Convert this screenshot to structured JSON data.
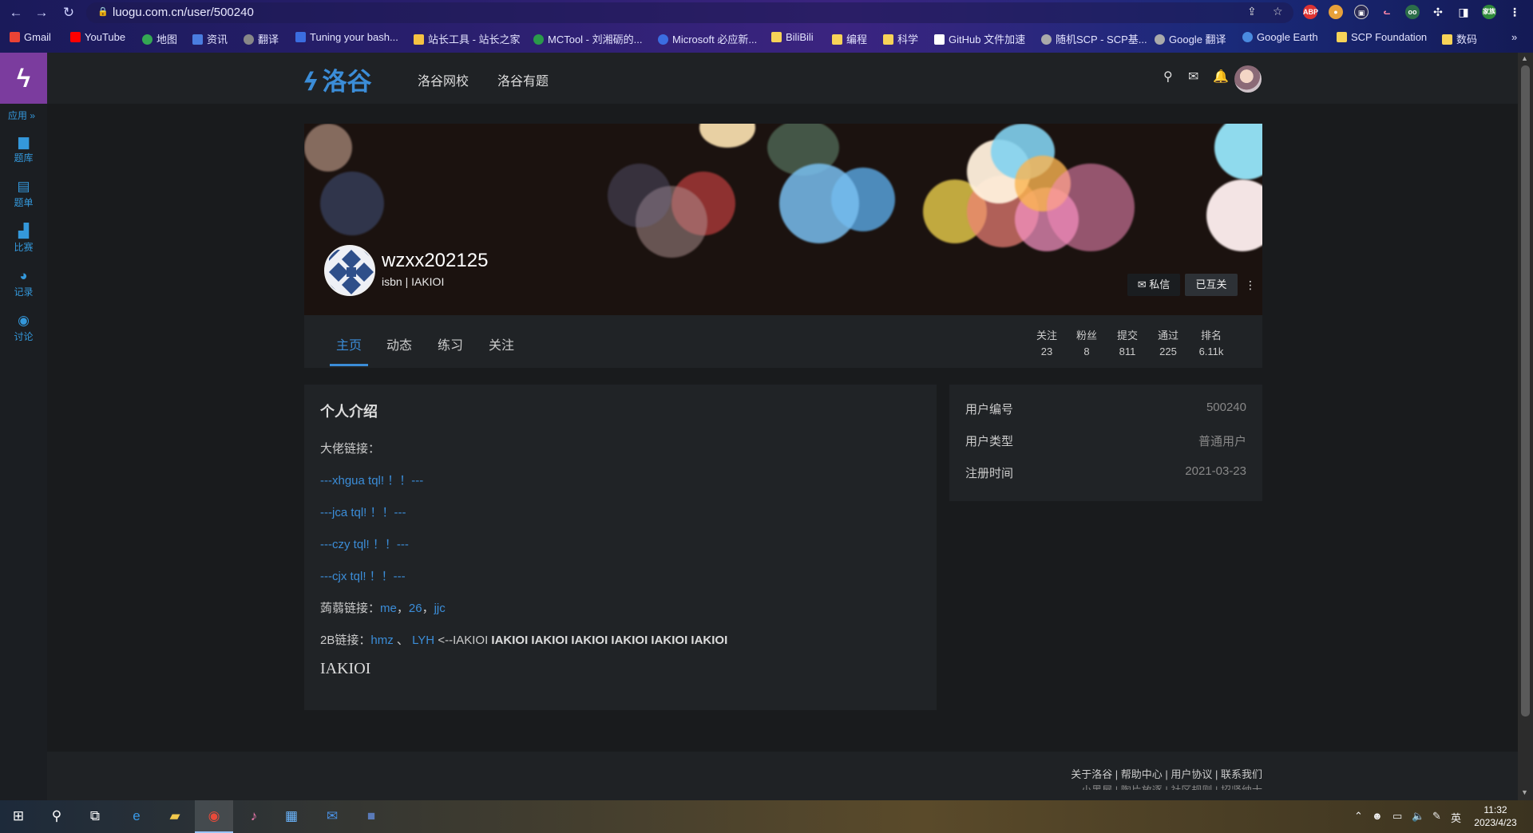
{
  "browser": {
    "url": "luogu.com.cn/user/500240",
    "bookmarks": [
      "Gmail",
      "YouTube",
      "地图",
      "资讯",
      "翻译",
      "Tuning your bash...",
      "站长工具 - 站长之家",
      "MCTool - 刘湘砺的...",
      "Microsoft 必应新...",
      "BiliBili",
      "编程",
      "科学",
      "GitHub 文件加速",
      "随机SCP - SCP基...",
      "Google 翻译",
      "Google Earth",
      "SCP Foundation",
      "数码"
    ],
    "more": "»",
    "profile_badge": "家族"
  },
  "appbar": {
    "menu_label": "应用",
    "items": [
      {
        "label": "题库",
        "icon": "book-icon"
      },
      {
        "label": "题单",
        "icon": "clipboard-icon"
      },
      {
        "label": "比赛",
        "icon": "bar-chart-icon"
      },
      {
        "label": "记录",
        "icon": "pie-chart-icon"
      },
      {
        "label": "讨论",
        "icon": "comments-icon"
      }
    ]
  },
  "site": {
    "brand": "洛谷",
    "nav": [
      "洛谷网校",
      "洛谷有题"
    ]
  },
  "profile": {
    "username": "wzxx202125",
    "tag": "isbn | IAKIOI",
    "msg_button": "私信",
    "follow_button": "已互关",
    "tabs": [
      "主页",
      "动态",
      "练习",
      "关注"
    ],
    "stats": [
      {
        "label": "关注",
        "value": "23"
      },
      {
        "label": "粉丝",
        "value": "8"
      },
      {
        "label": "提交",
        "value": "811"
      },
      {
        "label": "通过",
        "value": "225"
      },
      {
        "label": "排名",
        "value": "6.11k"
      }
    ]
  },
  "intro": {
    "title": "个人介绍",
    "line1": "大佬链接：",
    "links": [
      "---xhgua tql! ！！---",
      "---jca tql! ！！---",
      "---czy tql! ！！---",
      "---cjx tql! ！！---"
    ],
    "ruo_label": "蒟蒻链接：",
    "ruo_links": [
      "me",
      "26",
      "jjc"
    ],
    "ruo_sep": "，",
    "b2_label": "2B链接：",
    "b2_links": [
      "hmz",
      "LYH"
    ],
    "b2_sep": "、",
    "b2_tail": "<--IAKIOI",
    "b2_bold": "IAKIOI IAKIOI IAKIOI IAKIOI IAKIOI IAKIOI",
    "big": "IAKIOI"
  },
  "info": [
    {
      "key": "用户编号",
      "value": "500240"
    },
    {
      "key": "用户类型",
      "value": "普通用户"
    },
    {
      "key": "注册时间",
      "value": "2021-03-23"
    }
  ],
  "footer": {
    "links": "关于洛谷 | 帮助中心 | 用户协议 | 联系我们",
    "links2": "小黑屋 | 陶片放逐 | 社区规则 | 招贤纳士"
  },
  "taskbar": {
    "ime": "英",
    "time": "11:32",
    "date": "2023/4/23"
  }
}
